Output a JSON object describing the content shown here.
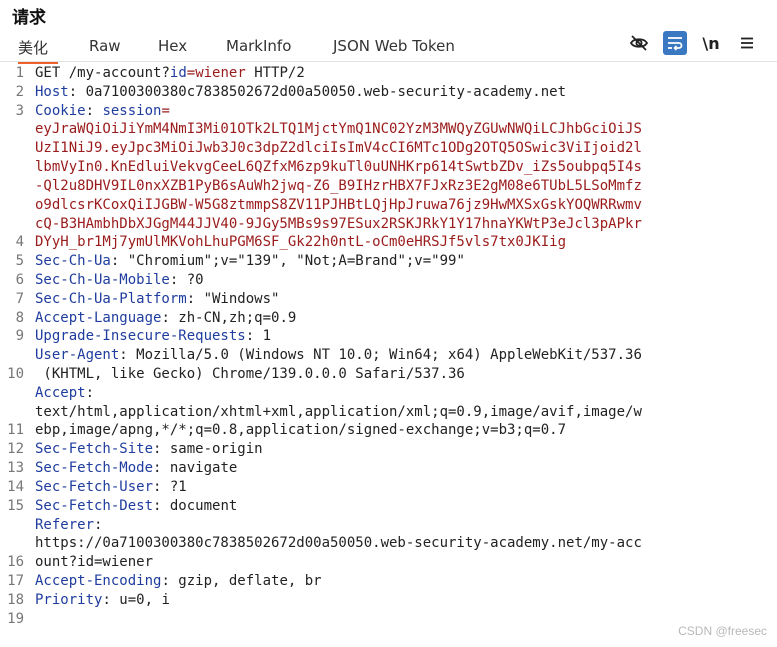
{
  "panel": {
    "title": "请求"
  },
  "tabs": [
    {
      "label": "美化"
    },
    {
      "label": "Raw"
    },
    {
      "label": "Hex"
    },
    {
      "label": "MarkInfo"
    },
    {
      "label": "JSON Web Token"
    }
  ],
  "toolbar": {
    "hide_icon": "eye-slash-icon",
    "wrap_icon": "wrap-lines-icon",
    "newline_label": "\\n",
    "menu_icon": "hamburger-menu-icon",
    "accent_color": "#3b78c2",
    "active_tab_color": "#f0602a"
  },
  "line_numbers": [
    "1",
    "2",
    "3",
    "",
    "",
    "",
    "",
    "",
    "",
    "4",
    "5",
    "6",
    "7",
    "8",
    "9",
    "",
    "10",
    "",
    "",
    "11",
    "12",
    "13",
    "14",
    "15",
    "",
    "",
    "16",
    "17",
    "18",
    "19"
  ],
  "request": {
    "method": "GET",
    "path": "/my-account?",
    "param_name": "id",
    "param_value": "wiener",
    "protocol": "HTTP/2",
    "cookie_name": "session",
    "cookie_lines": [
      "eyJraWQiOiJiYmM4NmI3Mi01OTk2LTQ1MjctYmQ1NC02YzM3MWQyZGUwNWQiLCJhbGciOiJS",
      "UzI1NiJ9.eyJpc3MiOiJwb3J0c3dpZ2dlciIsImV4cCI6MTc1ODg2OTQ5OSwic3ViIjoid2l",
      "lbmVyIn0.KnEdluiVekvgCeeL6QZfxM6zp9kuTl0uUNHKrp614tSwtbZDv_iZs5oubpq5I4s",
      "-Ql2u8DHV9IL0nxXZB1PyB6sAuWh2jwq-Z6_B9IHzrHBX7FJxRz3E2gM08e6TUbL5LSoMmfz",
      "o9dlcsrKCoxQiIJGBW-W5G8ztmmpS8ZV11PJHBtLQjHpJruwa76jz9HwMXSxGskYOQWRRwmv",
      "cQ-B3HAmbhDbXJGgM44JJV40-9JGy5MBs9s97ESux2RSKJRkY1Y17hnaYKWtP3eJcl3pAPkr",
      "DYyH_br1Mj7ymUlMKVohLhuPGM6SF_Gk22h0ntL-oCm0eHRSJf5vls7tx0JKIig"
    ],
    "headers": {
      "host": {
        "name": "Host",
        "value": "0a7100300380c7838502672d00a50050.web-security-academy.net"
      },
      "cookie": {
        "name": "Cookie"
      },
      "sec_ch_ua": {
        "name": "Sec-Ch-Ua",
        "value": "\"Chromium\";v=\"139\", \"Not;A=Brand\";v=\"99\""
      },
      "sec_ch_ua_mobile": {
        "name": "Sec-Ch-Ua-Mobile",
        "value": "?0"
      },
      "sec_ch_ua_platform": {
        "name": "Sec-Ch-Ua-Platform",
        "value": "\"Windows\""
      },
      "accept_language": {
        "name": "Accept-Language",
        "value": "zh-CN,zh;q=0.9"
      },
      "upgrade_insecure": {
        "name": "Upgrade-Insecure-Requests",
        "value": "1"
      },
      "user_agent": {
        "name": "User-Agent",
        "value": "Mozilla/5.0 (Windows NT 10.0; Win64; x64) AppleWebKit/537.36",
        "value_cont": " (KHTML, like Gecko) Chrome/139.0.0.0 Safari/537.36"
      },
      "accept": {
        "name": "Accept",
        "value_lines": [
          "text/html,application/xhtml+xml,application/xml;q=0.9,image/avif,image/w",
          "ebp,image/apng,*/*;q=0.8,application/signed-exchange;v=b3;q=0.7"
        ]
      },
      "sec_fetch_site": {
        "name": "Sec-Fetch-Site",
        "value": "same-origin"
      },
      "sec_fetch_mode": {
        "name": "Sec-Fetch-Mode",
        "value": "navigate"
      },
      "sec_fetch_user": {
        "name": "Sec-Fetch-User",
        "value": "?1"
      },
      "sec_fetch_dest": {
        "name": "Sec-Fetch-Dest",
        "value": "document"
      },
      "referer": {
        "name": "Referer",
        "value_lines": [
          "https://0a7100300380c7838502672d00a50050.web-security-academy.net/my-acc",
          "ount?id=wiener"
        ]
      },
      "accept_encoding": {
        "name": "Accept-Encoding",
        "value": "gzip, deflate, br"
      },
      "priority": {
        "name": "Priority",
        "value": "u=0, i"
      }
    }
  },
  "watermark": "CSDN @freesec"
}
